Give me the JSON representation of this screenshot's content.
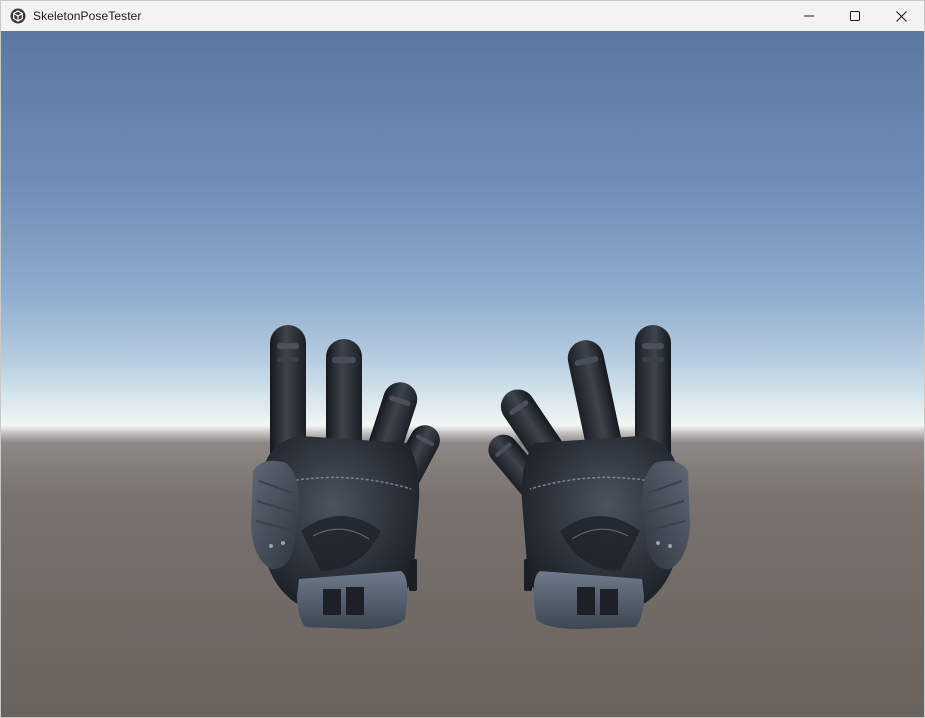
{
  "window": {
    "title": "SkeletonPoseTester",
    "icons": {
      "app": "unity-cube-icon",
      "minimize": "minimize-icon",
      "maximize": "maximize-icon",
      "close": "close-icon"
    }
  },
  "scene": {
    "colors": {
      "sky_top": "#5d7aa2",
      "sky_mid": "#8aa8cc",
      "horizon": "#f2f5f4",
      "ground_far": "#8a8583",
      "ground_near": "#6c635e",
      "glove_dark": "#1f242b",
      "glove_mid": "#3a4048",
      "glove_light": "#6b7584",
      "strap": "#566272"
    },
    "objects": [
      "left-glove",
      "right-glove"
    ]
  }
}
